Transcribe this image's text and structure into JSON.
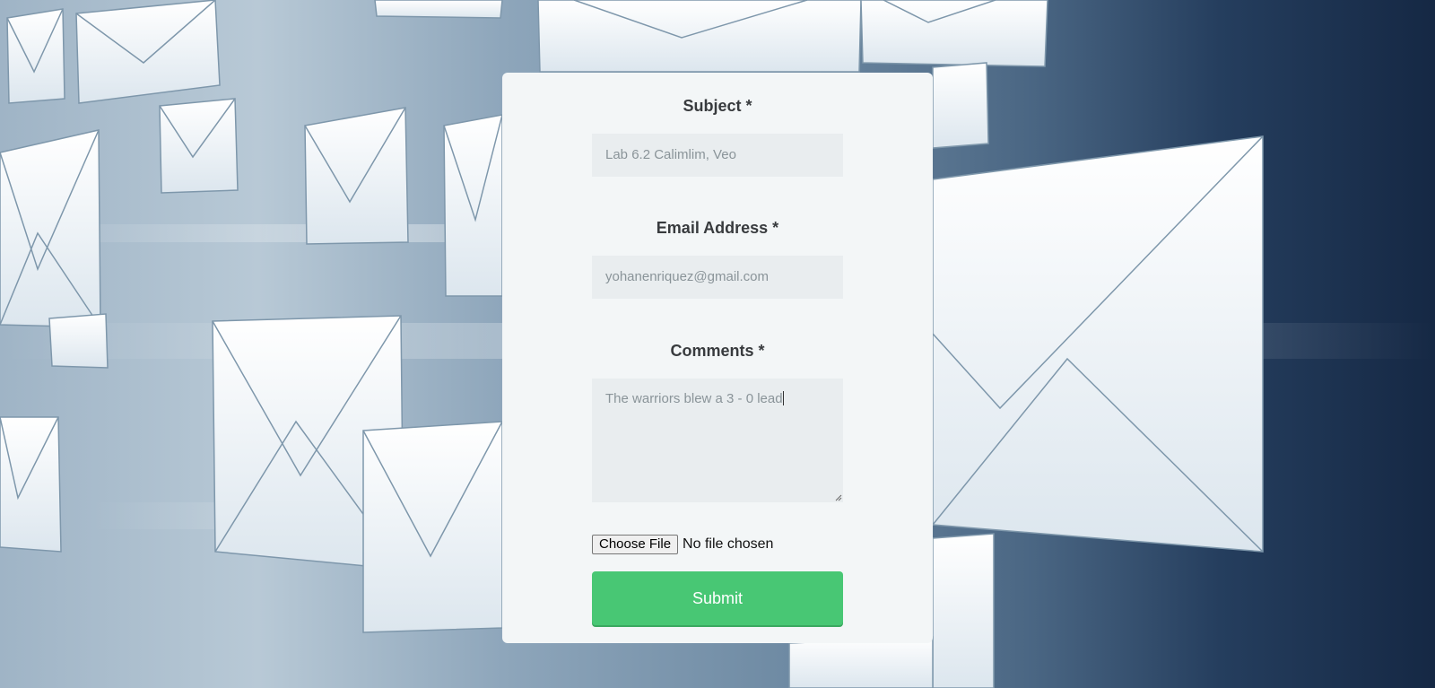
{
  "form": {
    "subject_label": "Subject *",
    "subject_value": "Lab 6.2 Calimlim, Veo",
    "email_label": "Email Address *",
    "email_value": "yohanenriquez@gmail.com",
    "comments_label": "Comments *",
    "comments_value": "The warriors blew a 3 - 0 lead",
    "file_button_label": "Choose File",
    "file_status": "No file chosen",
    "submit_label": "Submit"
  },
  "colors": {
    "card_background": "#f3f6f7",
    "field_background": "#e9edef",
    "submit_green": "#48c774"
  },
  "background": {
    "motif": "envelope-icon"
  }
}
